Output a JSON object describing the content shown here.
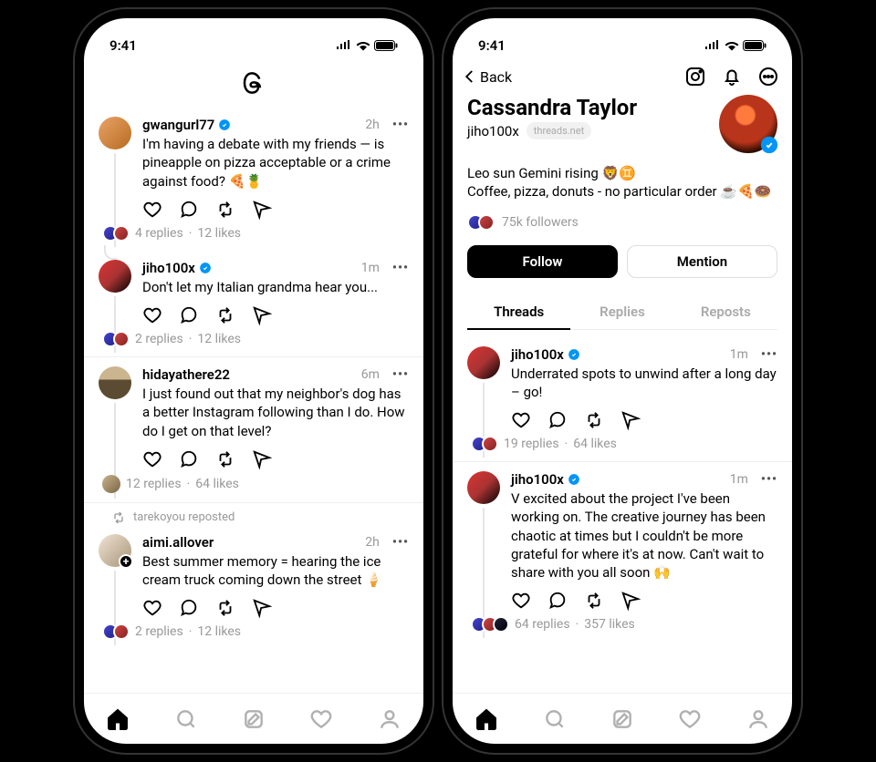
{
  "status": {
    "time": "9:41"
  },
  "feed": {
    "posts": [
      {
        "user": "gwangurl77",
        "verified": true,
        "time": "2h",
        "text": "I'm having a debate with my friends — is pineapple on pizza acceptable or a crime against food? 🍕🍍",
        "replies": "4 replies",
        "likes": "12 likes",
        "avatar": "orange"
      },
      {
        "user": "jiho100x",
        "verified": true,
        "time": "1m",
        "text": "Don't let my Italian grandma hear you...",
        "replies": "2 replies",
        "likes": "12 likes",
        "avatar": "red",
        "is_reply": true
      },
      {
        "user": "hidayathere22",
        "verified": false,
        "time": "6m",
        "text": "I just found out that my neighbor's dog has a better Instagram following than I do. How do I get on that level?",
        "replies": "12 replies",
        "likes": "64 likes",
        "avatar": "hat",
        "single_meta_avatar": true
      },
      {
        "repost_by": "tarekoyou reposted",
        "user": "aimi.allover",
        "verified": false,
        "time": "2h",
        "text": "Best summer memory = hearing the ice cream truck coming down the street 🍦",
        "replies": "2 replies",
        "likes": "12 likes",
        "avatar": "pale",
        "has_plus": true
      }
    ]
  },
  "profile": {
    "back_label": "Back",
    "display_name": "Cassandra Taylor",
    "handle": "jiho100x",
    "handle_domain": "threads.net",
    "bio_line1": "Leo sun Gemini rising 🦁♊",
    "bio_line2": "Coffee, pizza, donuts - no particular order ☕🍕🍩",
    "followers": "75k followers",
    "follow_label": "Follow",
    "mention_label": "Mention",
    "tabs": {
      "threads": "Threads",
      "replies": "Replies",
      "reposts": "Reposts"
    },
    "posts": [
      {
        "user": "jiho100x",
        "time": "1m",
        "text": "Underrated spots to unwind after a long day – go!",
        "replies": "19 replies",
        "likes": "64 likes"
      },
      {
        "user": "jiho100x",
        "time": "1m",
        "text": "V excited about the project I've been working on. The creative journey has been chaotic at times but I couldn't be more grateful for where it's at now. Can't wait to share with you all soon 🙌",
        "replies": "64 replies",
        "likes": "357 likes"
      }
    ]
  }
}
